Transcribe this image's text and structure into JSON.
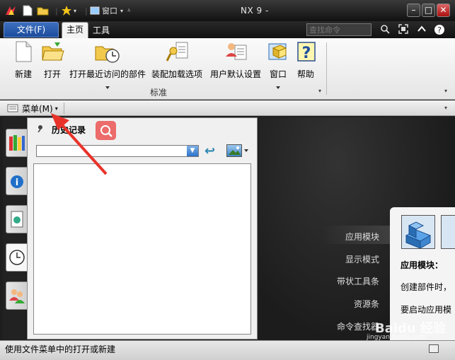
{
  "window": {
    "title": "NX 9 -",
    "window_menu_label": "窗口"
  },
  "tabs": {
    "file": "文件(F)",
    "home": "主页",
    "tools": "工具"
  },
  "command_search": {
    "placeholder": "查找命令"
  },
  "ribbon": {
    "buttons": [
      {
        "label": "新建",
        "icon": "new-file-icon"
      },
      {
        "label": "打开",
        "icon": "open-folder-icon"
      },
      {
        "label": "打开最近访问的部件",
        "icon": "recent-folder-icon"
      },
      {
        "label": "装配加载选项",
        "icon": "assembly-load-icon"
      },
      {
        "label": "用户默认设置",
        "icon": "user-defaults-icon"
      },
      {
        "label": "窗口",
        "icon": "window-icon"
      },
      {
        "label": "帮助",
        "icon": "help-icon"
      }
    ],
    "group_label": "标准"
  },
  "menu_bar": {
    "menu_label": "菜单(M)"
  },
  "history_panel": {
    "title": "历史记录"
  },
  "graphics": {
    "menu_items": [
      "应用模块",
      "显示模式",
      "带状工具条",
      "资源条",
      "命令查找器"
    ],
    "info_title": "应用模块：",
    "info_line1": "创建部件时，",
    "info_line2": "要启动应用模"
  },
  "status_bar": {
    "text": "使用文件菜单中的打开或新建"
  },
  "watermark": {
    "brand": "Baidu 经验",
    "url": "jingyan.baidu.com"
  },
  "colors": {
    "accent": "#1c4c9c",
    "search_button": "#ec6b6b",
    "arrow": "#e8332a"
  }
}
